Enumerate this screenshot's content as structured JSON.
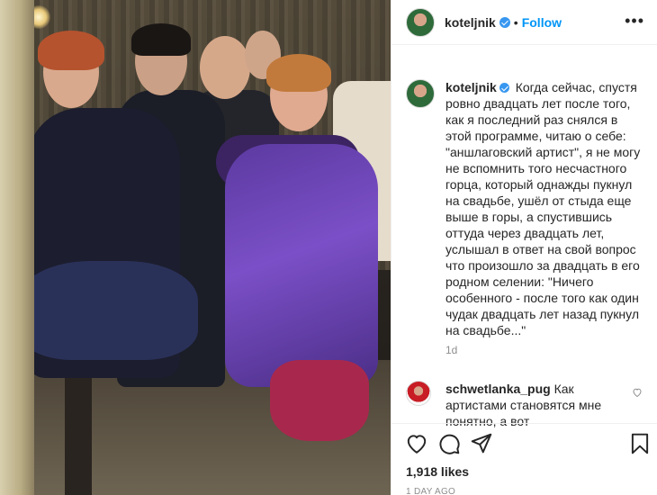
{
  "post": {
    "username": "koteljnik",
    "dot": "•",
    "follow_label": "Follow",
    "more_label": "•••",
    "caption": "Когда сейчас, спустя ровно двадцать лет после того, как я последний раз снялся в этой программе, читаю о себе: \"аншлаговский артист\", я не могу не вспомнить того несчастного горца, который однажды пукнул на свадьбе, ушёл от стыда еще выше в горы, а спустившись оттуда через двадцать лет, услышал в ответ на свой вопрос что произошло за двадцать в его родном селении: \"Ничего особенного - после того как один чудак двадцать лет назад пукнул на свадьбе...\"",
    "time": "1d",
    "likes": "1,918 likes",
    "date": "1 DAY AGO"
  },
  "comment": {
    "username": "schwetlanka_pug",
    "text": "Как артистами становятся мне понятно, а вот"
  },
  "icons": {
    "verified": "verified-badge-icon",
    "like": "heart-icon",
    "comment": "comment-icon",
    "share": "paper-plane-icon",
    "save": "bookmark-icon",
    "comment_like": "small-heart-icon",
    "more": "ellipsis-icon"
  },
  "colors": {
    "accent": "#0095f6",
    "verified": "#3897f0",
    "muted": "#8e8e8e"
  }
}
